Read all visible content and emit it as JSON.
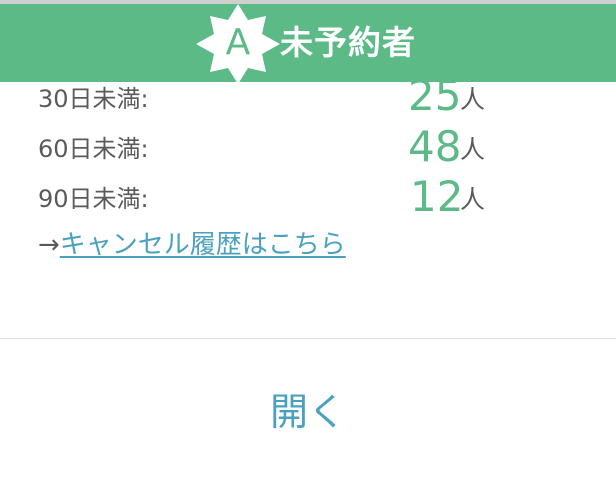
{
  "header": {
    "badge_letter": "A",
    "title": "未予約者"
  },
  "rows": [
    {
      "label": "30日未満:",
      "value": "25",
      "unit": "人"
    },
    {
      "label": "60日未満:",
      "value": "48",
      "unit": "人"
    },
    {
      "label": "90日未満:",
      "value": "12",
      "unit": "人"
    }
  ],
  "history": {
    "arrow": "→",
    "link_text": "キャンセル履歴はこちら"
  },
  "footer": {
    "open_label": "開く"
  },
  "colors": {
    "header_green": "#5cba87",
    "value_green": "#5cba87",
    "link_blue": "#4aa1bf",
    "label_gray": "#5a5a5a"
  },
  "icons": {
    "badge": "star-badge-icon"
  }
}
